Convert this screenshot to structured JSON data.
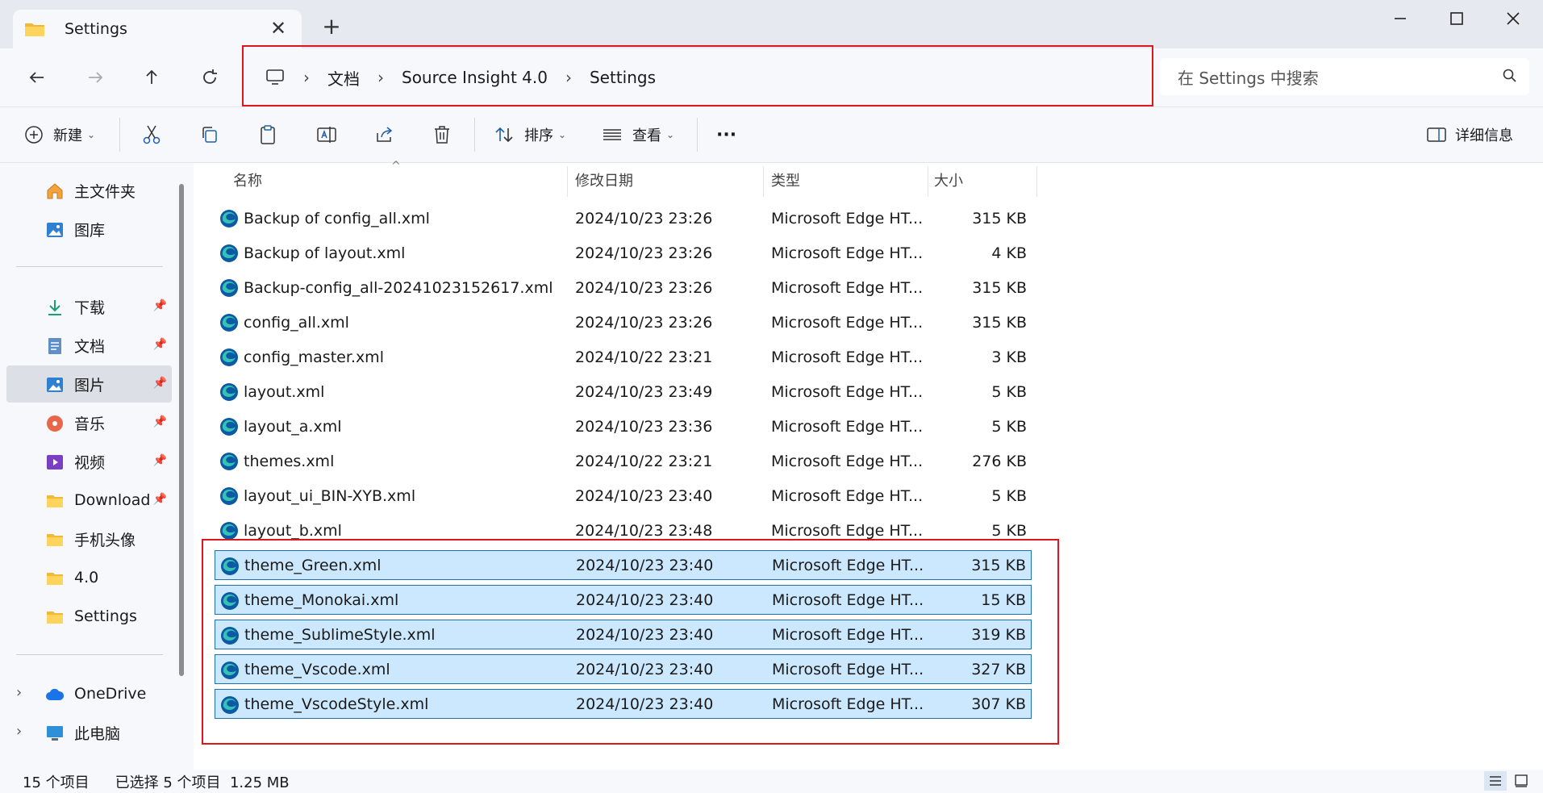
{
  "tab": {
    "title": "Settings",
    "close": "✕",
    "new": "+"
  },
  "window": {
    "minimize": "—",
    "maximize": "☐",
    "close": "✕"
  },
  "breadcrumb": [
    "文档",
    "Source Insight 4.0",
    "Settings"
  ],
  "breadcrumb_sep": "›",
  "search": {
    "placeholder": "在 Settings 中搜索"
  },
  "toolbar": {
    "new_label": "新建",
    "sort_label": "排序",
    "view_label": "查看",
    "more_label": "···",
    "details_label": "详细信息"
  },
  "sidebar": {
    "quick": [
      {
        "label": "主文件夹",
        "icon": "home-icon"
      },
      {
        "label": "图库",
        "icon": "gallery-icon"
      }
    ],
    "pinned": [
      {
        "label": "下载",
        "icon": "download-icon"
      },
      {
        "label": "文档",
        "icon": "document-icon"
      },
      {
        "label": "图片",
        "icon": "pictures-icon"
      },
      {
        "label": "音乐",
        "icon": "music-icon"
      },
      {
        "label": "视频",
        "icon": "video-icon"
      },
      {
        "label": "Download",
        "icon": "folder-icon"
      },
      {
        "label": "手机头像",
        "icon": "folder-icon"
      },
      {
        "label": "4.0",
        "icon": "folder-icon"
      },
      {
        "label": "Settings",
        "icon": "folder-icon"
      }
    ],
    "drives": [
      {
        "label": "OneDrive",
        "icon": "cloud-icon"
      },
      {
        "label": "此电脑",
        "icon": "computer-icon"
      }
    ],
    "active": "图片"
  },
  "columns": {
    "name": "名称",
    "date": "修改日期",
    "type": "类型",
    "size": "大小"
  },
  "files": [
    {
      "name": "Backup of config_all.xml",
      "date": "2024/10/23 23:26",
      "type": "Microsoft Edge HT...",
      "size": "315 KB",
      "selected": false
    },
    {
      "name": "Backup of layout.xml",
      "date": "2024/10/23 23:26",
      "type": "Microsoft Edge HT...",
      "size": "4 KB",
      "selected": false
    },
    {
      "name": "Backup-config_all-20241023152617.xml",
      "date": "2024/10/23 23:26",
      "type": "Microsoft Edge HT...",
      "size": "315 KB",
      "selected": false
    },
    {
      "name": "config_all.xml",
      "date": "2024/10/23 23:26",
      "type": "Microsoft Edge HT...",
      "size": "315 KB",
      "selected": false
    },
    {
      "name": "config_master.xml",
      "date": "2024/10/22 23:21",
      "type": "Microsoft Edge HT...",
      "size": "3 KB",
      "selected": false
    },
    {
      "name": "layout.xml",
      "date": "2024/10/23 23:49",
      "type": "Microsoft Edge HT...",
      "size": "5 KB",
      "selected": false
    },
    {
      "name": "layout_a.xml",
      "date": "2024/10/23 23:36",
      "type": "Microsoft Edge HT...",
      "size": "5 KB",
      "selected": false
    },
    {
      "name": "themes.xml",
      "date": "2024/10/22 23:21",
      "type": "Microsoft Edge HT...",
      "size": "276 KB",
      "selected": false
    },
    {
      "name": "layout_ui_BIN-XYB.xml",
      "date": "2024/10/23 23:40",
      "type": "Microsoft Edge HT...",
      "size": "5 KB",
      "selected": false
    },
    {
      "name": "layout_b.xml",
      "date": "2024/10/23 23:48",
      "type": "Microsoft Edge HT...",
      "size": "5 KB",
      "selected": false
    },
    {
      "name": "theme_Green.xml",
      "date": "2024/10/23 23:40",
      "type": "Microsoft Edge HT...",
      "size": "315 KB",
      "selected": true
    },
    {
      "name": "theme_Monokai.xml",
      "date": "2024/10/23 23:40",
      "type": "Microsoft Edge HT...",
      "size": "15 KB",
      "selected": true
    },
    {
      "name": "theme_SublimeStyle.xml",
      "date": "2024/10/23 23:40",
      "type": "Microsoft Edge HT...",
      "size": "319 KB",
      "selected": true
    },
    {
      "name": "theme_Vscode.xml",
      "date": "2024/10/23 23:40",
      "type": "Microsoft Edge HT...",
      "size": "327 KB",
      "selected": true
    },
    {
      "name": "theme_VscodeStyle.xml",
      "date": "2024/10/23 23:40",
      "type": "Microsoft Edge HT...",
      "size": "307 KB",
      "selected": true
    }
  ],
  "status": {
    "count": "15 个项目",
    "selection": "已选择 5 个项目  1.25 MB"
  },
  "colors": {
    "selection_bg": "#cce8ff",
    "selection_border": "#1f6fb0",
    "highlight_box": "#e0161f",
    "edge_blue": "#0c59a4",
    "edge_green": "#35c1b5"
  }
}
